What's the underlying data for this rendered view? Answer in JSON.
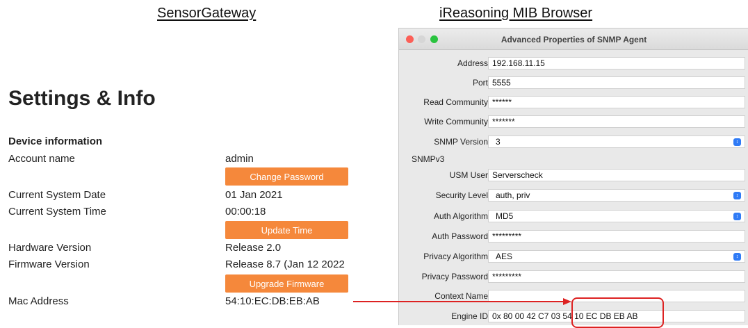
{
  "captions": {
    "left": "SensorGateway",
    "right": "iReasoning MIB Browser"
  },
  "settings": {
    "title": "Settings & Info",
    "section": "Device information",
    "account_name": {
      "label": "Account name",
      "value": "admin"
    },
    "change_password": "Change Password",
    "system_date": {
      "label": "Current System Date",
      "value": "01 Jan 2021"
    },
    "system_time": {
      "label": "Current System Time",
      "value": "00:00:18"
    },
    "update_time": "Update Time",
    "hardware_version": {
      "label": "Hardware Version",
      "value": "Release 2.0"
    },
    "firmware_version": {
      "label": "Firmware Version",
      "value": "Release 8.7 (Jan 12 2022"
    },
    "upgrade_firmware": "Upgrade Firmware",
    "mac_address": {
      "label": "Mac Address",
      "value": "54:10:EC:DB:EB:AB"
    }
  },
  "agent_window": {
    "title": "Advanced Properties of SNMP Agent",
    "fields": {
      "address": {
        "label": "Address",
        "value": "192.168.11.15"
      },
      "port": {
        "label": "Port",
        "value": "5555"
      },
      "read_community": {
        "label": "Read Community",
        "value": "******"
      },
      "write_community": {
        "label": "Write Community",
        "value": "*******"
      },
      "snmp_version": {
        "label": "SNMP Version",
        "value": "3"
      },
      "usm_user": {
        "label": "USM User",
        "value": "Serverscheck"
      },
      "security_level": {
        "label": "Security Level",
        "value": "auth, priv"
      },
      "auth_algorithm": {
        "label": "Auth Algorithm",
        "value": "MD5"
      },
      "auth_password": {
        "label": "Auth Password",
        "value": "*********"
      },
      "privacy_algorithm": {
        "label": "Privacy Algorithm",
        "value": "AES"
      },
      "privacy_password": {
        "label": "Privacy Password",
        "value": "*********"
      },
      "context_name": {
        "label": "Context Name",
        "value": ""
      },
      "engine_id": {
        "label": "Engine ID",
        "value": "0x 80 00 42 C7 03 54 10 EC DB EB AB"
      }
    },
    "section_snmpv3": "SNMPv3"
  },
  "colors": {
    "button_orange": "#f5883b",
    "arrow_red": "#dd2222",
    "select_blue": "#2f7bf6"
  }
}
